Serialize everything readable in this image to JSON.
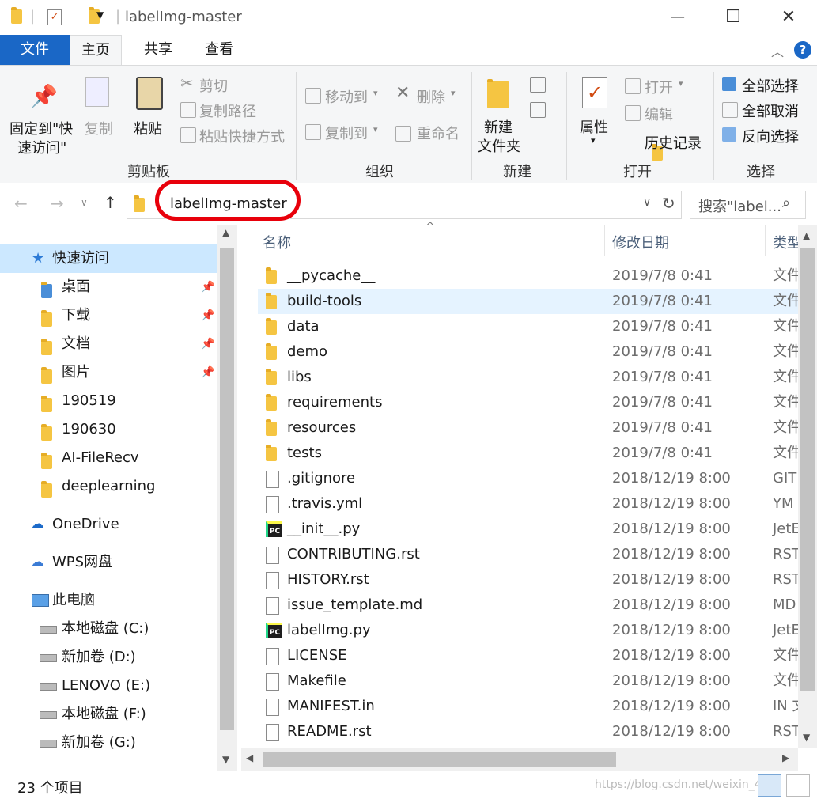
{
  "window": {
    "title": "labelImg-master",
    "minimize": "—",
    "maximize": "☐",
    "close": "✕"
  },
  "tabs": {
    "file": "文件",
    "home": "主页",
    "share": "共享",
    "view": "查看"
  },
  "ribbon": {
    "clipboard": {
      "pin": "固定到\"快",
      "pin2": "速访问\"",
      "copy": "复制",
      "paste": "粘贴",
      "cut": "剪切",
      "copy_path": "复制路径",
      "paste_shortcut": "粘贴快捷方式",
      "title": "剪贴板"
    },
    "organize": {
      "move_to": "移动到",
      "copy_to": "复制到",
      "delete": "删除",
      "rename": "重命名",
      "title": "组织"
    },
    "new": {
      "new_folder": "新建",
      "new_folder2": "文件夹",
      "title": "新建"
    },
    "open": {
      "properties": "属性",
      "open": "打开",
      "edit": "编辑",
      "history": "历史记录",
      "title": "打开"
    },
    "select": {
      "select_all": "全部选择",
      "select_none": "全部取消",
      "invert": "反向选择",
      "title": "选择"
    }
  },
  "address": {
    "path": "labelImg-master",
    "search_placeholder": "搜索\"label..."
  },
  "nav": {
    "items": [
      {
        "label": "快速访问"
      },
      {
        "label": "桌面"
      },
      {
        "label": "下载"
      },
      {
        "label": "文档"
      },
      {
        "label": "图片"
      },
      {
        "label": "190519"
      },
      {
        "label": "190630"
      },
      {
        "label": "AI-FileRecv"
      },
      {
        "label": "deeplearning"
      },
      {
        "label": "OneDrive"
      },
      {
        "label": "WPS网盘"
      },
      {
        "label": "此电脑"
      },
      {
        "label": "本地磁盘 (C:)"
      },
      {
        "label": "新加卷 (D:)"
      },
      {
        "label": "LENOVO (E:)"
      },
      {
        "label": "本地磁盘 (F:)"
      },
      {
        "label": "新加卷 (G:)"
      }
    ]
  },
  "list": {
    "headers": {
      "name": "名称",
      "date": "修改日期",
      "type": "类型"
    },
    "rows": [
      {
        "name": "__pycache__",
        "date": "2019/7/8 0:41",
        "type": "文件",
        "kind": "folder"
      },
      {
        "name": "build-tools",
        "date": "2019/7/8 0:41",
        "type": "文件",
        "kind": "folder"
      },
      {
        "name": "data",
        "date": "2019/7/8 0:41",
        "type": "文件",
        "kind": "folder"
      },
      {
        "name": "demo",
        "date": "2019/7/8 0:41",
        "type": "文件",
        "kind": "folder"
      },
      {
        "name": "libs",
        "date": "2019/7/8 0:41",
        "type": "文件",
        "kind": "folder"
      },
      {
        "name": "requirements",
        "date": "2019/7/8 0:41",
        "type": "文件",
        "kind": "folder"
      },
      {
        "name": "resources",
        "date": "2019/7/8 0:41",
        "type": "文件",
        "kind": "folder"
      },
      {
        "name": "tests",
        "date": "2019/7/8 0:41",
        "type": "文件",
        "kind": "folder"
      },
      {
        "name": ".gitignore",
        "date": "2018/12/19 8:00",
        "type": "GIT",
        "kind": "doc"
      },
      {
        "name": ".travis.yml",
        "date": "2018/12/19 8:00",
        "type": "YM",
        "kind": "doc"
      },
      {
        "name": "__init__.py",
        "date": "2018/12/19 8:00",
        "type": "JetE",
        "kind": "py"
      },
      {
        "name": "CONTRIBUTING.rst",
        "date": "2018/12/19 8:00",
        "type": "RST",
        "kind": "doc"
      },
      {
        "name": "HISTORY.rst",
        "date": "2018/12/19 8:00",
        "type": "RST",
        "kind": "doc"
      },
      {
        "name": "issue_template.md",
        "date": "2018/12/19 8:00",
        "type": "MD",
        "kind": "doc"
      },
      {
        "name": "labelImg.py",
        "date": "2018/12/19 8:00",
        "type": "JetE",
        "kind": "py"
      },
      {
        "name": "LICENSE",
        "date": "2018/12/19 8:00",
        "type": "文件",
        "kind": "doc"
      },
      {
        "name": "Makefile",
        "date": "2018/12/19 8:00",
        "type": "文件",
        "kind": "doc"
      },
      {
        "name": "MANIFEST.in",
        "date": "2018/12/19 8:00",
        "type": "IN 文",
        "kind": "doc"
      },
      {
        "name": "README.rst",
        "date": "2018/12/19 8:00",
        "type": "RST",
        "kind": "doc"
      }
    ]
  },
  "status": {
    "count": "23 个项目",
    "watermark": "https://blog.csdn.net/weixin_4..."
  },
  "colors": {
    "accent": "#1a67c6",
    "folder": "#f5c542",
    "selected_row": "#e5f3ff",
    "annotation": "#e8000b"
  }
}
